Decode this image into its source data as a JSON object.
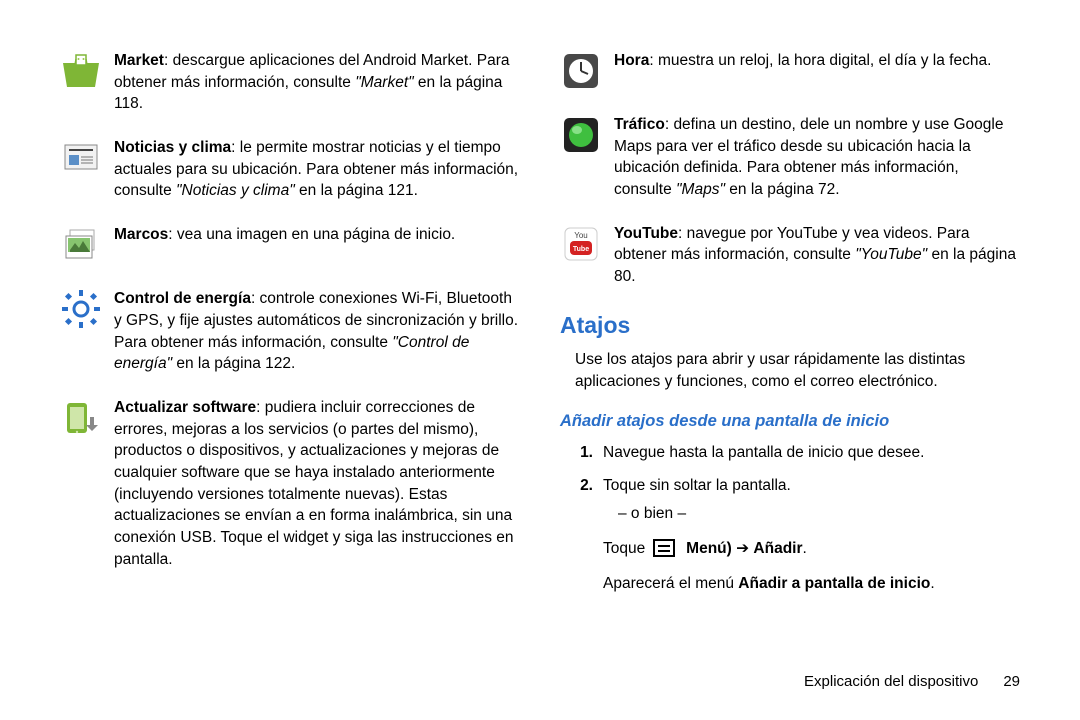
{
  "left": {
    "market": {
      "label": "Market",
      "text": ": descargue aplicaciones del Android Market. Para obtener más información, consulte",
      "ref": "\"Market\"",
      "tail": " en la página 118."
    },
    "news": {
      "label": "Noticias y clima",
      "text": ": le permite mostrar noticias y el tiempo actuales para su ubicación. Para obtener más información, consulte",
      "ref": "\"Noticias y clima\"",
      "tail": " en la página 121."
    },
    "frames": {
      "label": "Marcos",
      "text": ": vea una imagen en una página de inicio."
    },
    "power": {
      "label": "Control de energía",
      "text": ": controle conexiones Wi-Fi, Bluetooth y GPS, y fije ajustes automáticos de sincronización y brillo. Para obtener más información, consulte",
      "ref": "\"Control de energía\"",
      "tail": " en la página 122."
    },
    "update": {
      "label": "Actualizar software",
      "text": ": pudiera incluir correcciones de errores, mejoras a los servicios (o partes del mismo), productos o dispositivos, y actualizaciones y mejoras de cualquier software que se haya instalado anteriormente (incluyendo versiones totalmente nuevas). Estas actualizaciones se envían a en forma inalámbrica, sin una conexión USB. Toque el widget y siga las instrucciones en pantalla."
    }
  },
  "right": {
    "clock": {
      "label": "Hora",
      "text": ": muestra un reloj, la hora digital, el día y la fecha."
    },
    "traffic": {
      "label": "Tráfico",
      "text": ": defina un destino, dele un nombre y use Google Maps para ver el tráfico desde su ubicación hacia la ubicación definida. Para obtener más información, consulte",
      "ref": "\"Maps\"",
      "tail": " en la página 72."
    },
    "youtube": {
      "label": "YouTube",
      "text": ": navegue por YouTube y vea videos. Para obtener más información, consulte",
      "ref": "\"YouTube\"",
      "tail": " en la página 80."
    },
    "atajos_heading": "Atajos",
    "atajos_intro": "Use los atajos para abrir y usar rápidamente las distintas aplicaciones y funciones, como el correo electrónico.",
    "sub_heading": "Añadir atajos desde una pantalla de inicio",
    "step1_num": "1.",
    "step1": "Navegue hasta la pantalla de inicio que desee.",
    "step2_num": "2.",
    "step2a": "Toque sin soltar la pantalla.",
    "opt_line": "– o bien –",
    "step2b_pre": "Toque ",
    "step2b_menu": "Menú)",
    "step2b_arrow": " ➔ ",
    "step2b_add": "Añadir",
    "step2b_dot": ".",
    "step2c_pre": "Aparecerá el menú ",
    "step2c_bold": "Añadir a pantalla de inicio",
    "step2c_dot": "."
  },
  "footer": {
    "section": "Explicación del dispositivo",
    "page": "29"
  }
}
